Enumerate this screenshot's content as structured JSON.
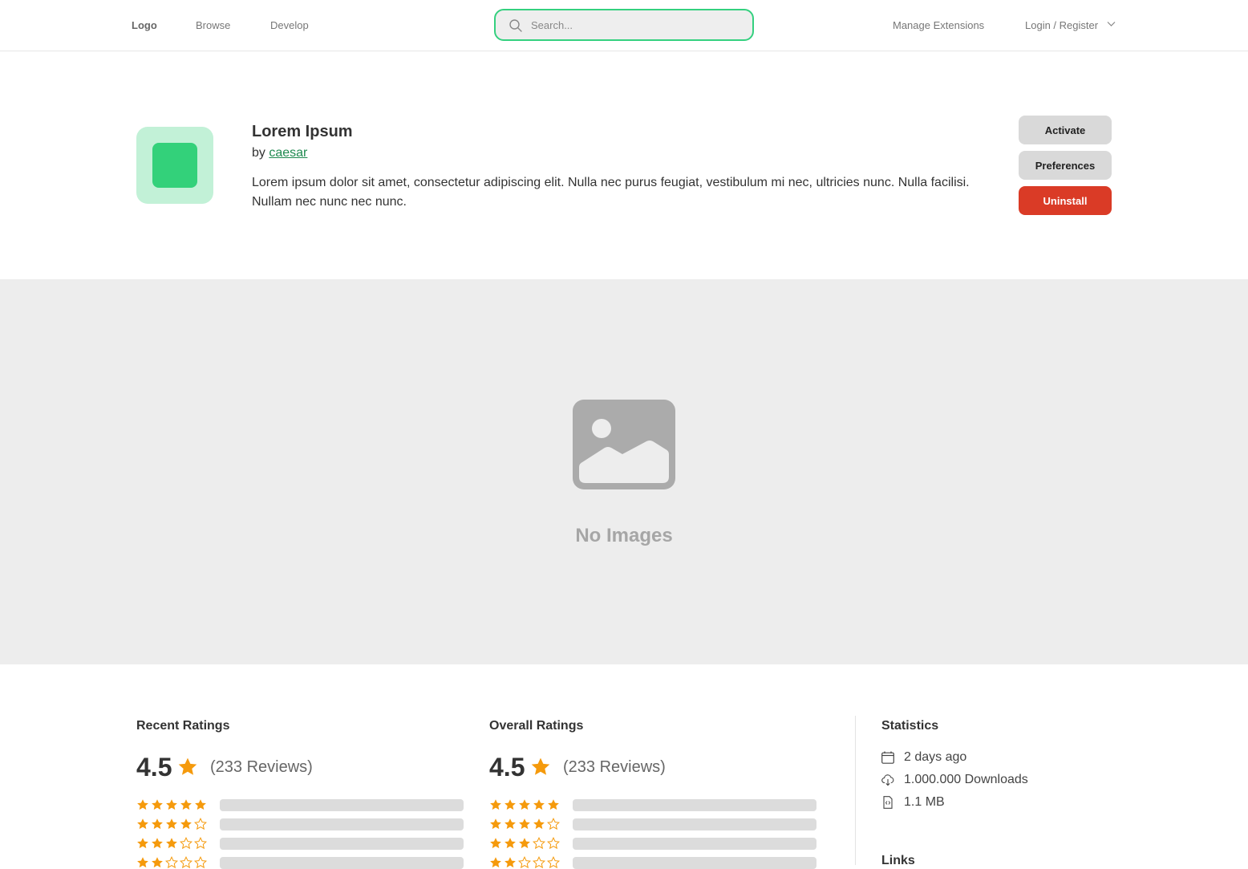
{
  "nav": {
    "logo": "Logo",
    "browse": "Browse",
    "develop": "Develop",
    "search_placeholder": "Search...",
    "manage": "Manage Extensions",
    "login": "Login / Register"
  },
  "extension": {
    "title": "Lorem Ipsum",
    "by_prefix": "by",
    "author": "caesar",
    "description": "Lorem ipsum dolor sit amet, consectetur adipiscing elit. Nulla nec purus feugiat, vestibulum mi nec, ultricies nunc. Nulla facilisi. Nullam nec nunc nec nunc.",
    "icon_bg": "#c2f1d7",
    "icon_fg": "#33d17a"
  },
  "actions": {
    "activate": "Activate",
    "preferences": "Preferences",
    "uninstall": "Uninstall",
    "uninstall_color": "#da3b26"
  },
  "gallery": {
    "empty_label": "No Images"
  },
  "recent_ratings": {
    "title": "Recent Ratings",
    "score": "4.5",
    "reviews": "(233 Reviews)",
    "rows": [
      5,
      4,
      3,
      2
    ]
  },
  "overall_ratings": {
    "title": "Overall Ratings",
    "score": "4.5",
    "reviews": "(233 Reviews)",
    "rows": [
      5,
      4,
      3,
      2
    ]
  },
  "statistics": {
    "title": "Statistics",
    "updated": "2 days ago",
    "downloads": "1.000.000 Downloads",
    "size": "1.1 MB"
  },
  "links": {
    "title": "Links"
  },
  "colors": {
    "accent": "#34d07f",
    "star": "#f59a0c"
  }
}
